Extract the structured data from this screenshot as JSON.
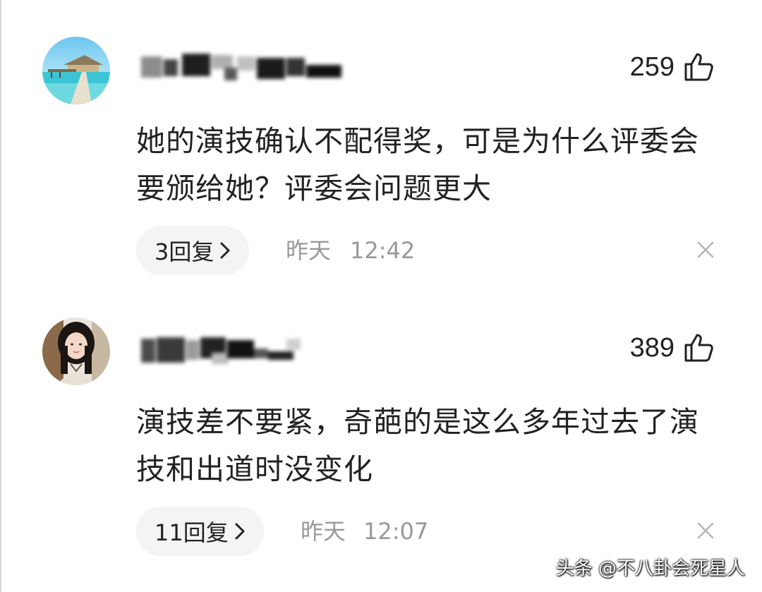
{
  "comments": [
    {
      "likes": "259",
      "text": "她的演技确认不配得奖，可是为什么评委会要颁给她？评委会问题更大",
      "replies_label": "3回复",
      "date": "昨天",
      "time": "12:42"
    },
    {
      "likes": "389",
      "text": "演技差不要紧，奇葩的是这么多年过去了演技和出道时没变化",
      "replies_label": "11回复",
      "date": "昨天",
      "time": "12:07"
    }
  ],
  "watermark": "头条 @不八卦会死星人",
  "icons": {
    "like": "thumbs-up-icon",
    "reply_chevron": "chevron-right-icon",
    "dismiss": "close-icon"
  },
  "colors": {
    "text": "#222222",
    "meta": "#999999",
    "pill": "#f4f4f4"
  }
}
